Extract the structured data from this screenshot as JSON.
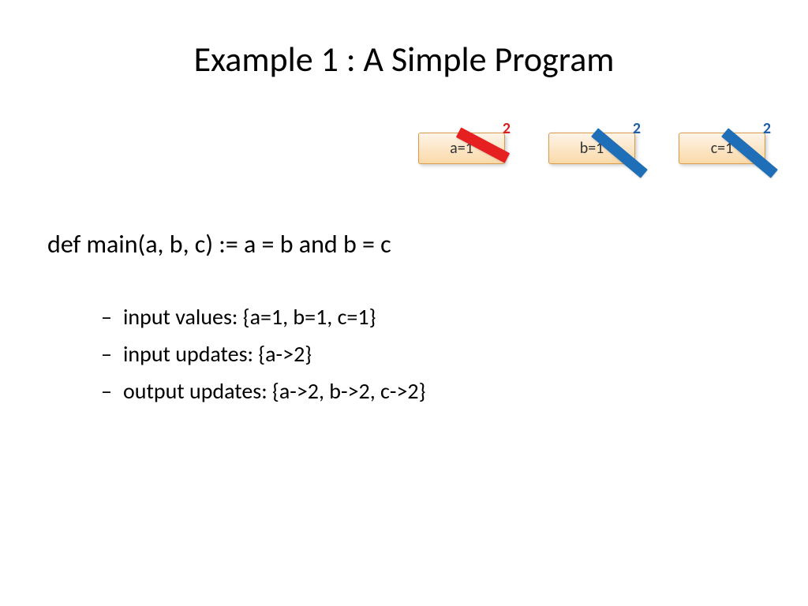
{
  "title": "Example 1 : A Simple Program",
  "boxes": {
    "a": {
      "label": "a=1",
      "new": "2"
    },
    "b": {
      "label": "b=1",
      "new": "2"
    },
    "c": {
      "label": "c=1",
      "new": "2"
    }
  },
  "code": "def main(a, b, c) := a = b and b = c",
  "bullets": {
    "input_values": "input values: {a=1, b=1, c=1}",
    "input_updates": "input updates: {a->2}",
    "output_updates": "output updates: {a->2, b->2, c->2}"
  }
}
